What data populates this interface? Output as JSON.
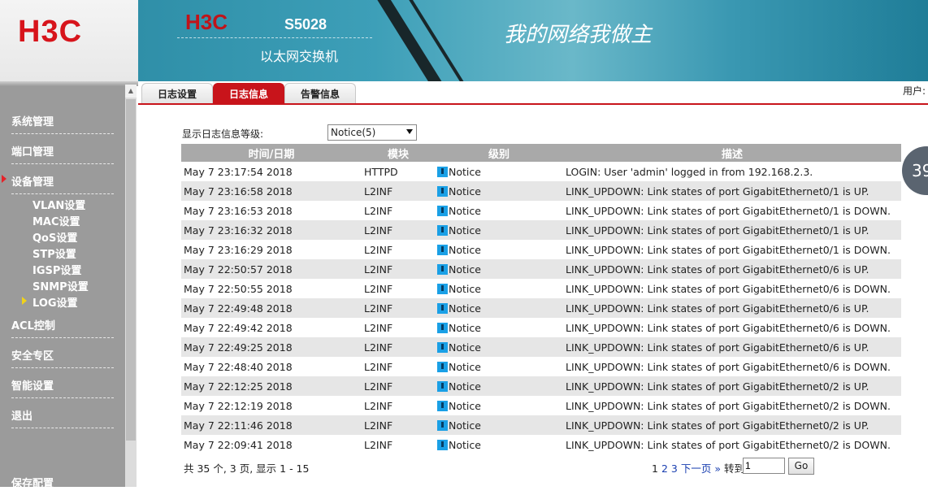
{
  "header": {
    "logo_text": "H3C",
    "brand": "H3C",
    "model": "S5028",
    "subtitle": "以太网交换机",
    "slogan": "我的网络我做主"
  },
  "sidebar": {
    "items": [
      {
        "label": "系统管理"
      },
      {
        "label": "端口管理"
      },
      {
        "label": "设备管理",
        "active": true
      },
      {
        "label": "ACL控制"
      },
      {
        "label": "安全专区"
      },
      {
        "label": "智能设置"
      },
      {
        "label": "退出"
      },
      {
        "label": "保存配置"
      }
    ],
    "subitems": [
      {
        "label": "VLAN设置"
      },
      {
        "label": "MAC设置"
      },
      {
        "label": "QoS设置"
      },
      {
        "label": "STP设置"
      },
      {
        "label": "IGSP设置"
      },
      {
        "label": "SNMP设置"
      },
      {
        "label": "LOG设置",
        "active": true
      }
    ]
  },
  "tabs": [
    {
      "label": "日志设置"
    },
    {
      "label": "日志信息",
      "active": true
    },
    {
      "label": "告警信息"
    }
  ],
  "user_label": "用户:",
  "badge_text": "39",
  "filter": {
    "label": "显示日志信息等级:",
    "selected": "Notice(5)"
  },
  "table": {
    "headers": [
      "时间/日期",
      "模块",
      "级别",
      "描述"
    ],
    "rows": [
      [
        "May 7 23:17:54 2018",
        "HTTPD",
        "Notice",
        "LOGIN: User 'admin' logged in from 192.168.2.3."
      ],
      [
        "May 7 23:16:58 2018",
        "L2INF",
        "Notice",
        "LINK_UPDOWN: Link states of port GigabitEthernet0/1 is UP."
      ],
      [
        "May 7 23:16:53 2018",
        "L2INF",
        "Notice",
        "LINK_UPDOWN: Link states of port GigabitEthernet0/1 is DOWN."
      ],
      [
        "May 7 23:16:32 2018",
        "L2INF",
        "Notice",
        "LINK_UPDOWN: Link states of port GigabitEthernet0/1 is UP."
      ],
      [
        "May 7 23:16:29 2018",
        "L2INF",
        "Notice",
        "LINK_UPDOWN: Link states of port GigabitEthernet0/1 is DOWN."
      ],
      [
        "May 7 22:50:57 2018",
        "L2INF",
        "Notice",
        "LINK_UPDOWN: Link states of port GigabitEthernet0/6 is UP."
      ],
      [
        "May 7 22:50:55 2018",
        "L2INF",
        "Notice",
        "LINK_UPDOWN: Link states of port GigabitEthernet0/6 is DOWN."
      ],
      [
        "May 7 22:49:48 2018",
        "L2INF",
        "Notice",
        "LINK_UPDOWN: Link states of port GigabitEthernet0/6 is UP."
      ],
      [
        "May 7 22:49:42 2018",
        "L2INF",
        "Notice",
        "LINK_UPDOWN: Link states of port GigabitEthernet0/6 is DOWN."
      ],
      [
        "May 7 22:49:25 2018",
        "L2INF",
        "Notice",
        "LINK_UPDOWN: Link states of port GigabitEthernet0/6 is UP."
      ],
      [
        "May 7 22:48:40 2018",
        "L2INF",
        "Notice",
        "LINK_UPDOWN: Link states of port GigabitEthernet0/6 is DOWN."
      ],
      [
        "May 7 22:12:25 2018",
        "L2INF",
        "Notice",
        "LINK_UPDOWN: Link states of port GigabitEthernet0/2 is UP."
      ],
      [
        "May 7 22:12:19 2018",
        "L2INF",
        "Notice",
        "LINK_UPDOWN: Link states of port GigabitEthernet0/2 is DOWN."
      ],
      [
        "May 7 22:11:46 2018",
        "L2INF",
        "Notice",
        "LINK_UPDOWN: Link states of port GigabitEthernet0/2 is UP."
      ],
      [
        "May 7 22:09:41 2018",
        "L2INF",
        "Notice",
        "LINK_UPDOWN: Link states of port GigabitEthernet0/2 is DOWN."
      ]
    ]
  },
  "footer": {
    "summary": "共 35 个, 3 页, 显示 1 - 15",
    "pages": [
      "1",
      "2",
      "3"
    ],
    "next": "下一页",
    "next_arrow": "»",
    "goto_label": "转到",
    "goto_value": "1",
    "go_label": "Go"
  },
  "colors": {
    "brand_red": "#c8141b",
    "sidebar_gray": "#9b9b9b",
    "header_teal": "#3d9fb8",
    "level_icon_blue": "#1aa0e6"
  }
}
